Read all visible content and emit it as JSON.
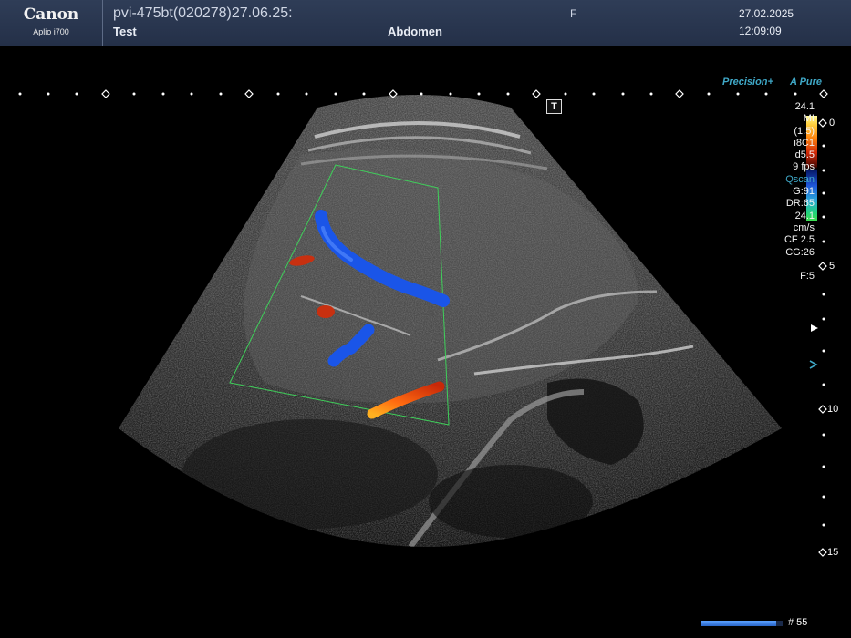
{
  "header": {
    "brand": "Canon",
    "model": "Aplio i700",
    "patient_id": "pvi-475bt(020278)27.06.25:",
    "patient_name": "Test",
    "preset": "Abdomen",
    "sex": "F",
    "date": "27.02.2025",
    "time": "12:09:09"
  },
  "modes": {
    "precision": "Precision+",
    "apure": "A Pure"
  },
  "t_marker": "T",
  "parameters": {
    "scale_top": "24.1",
    "mi": "MI",
    "mi_value": "(1.5)",
    "probe": "i8C1",
    "depth": "d5.5",
    "frame_rate": "9 fps",
    "qscan": "Qscan",
    "gain": "G:91",
    "dynamic_range": "DR:65",
    "scale_bottom": "24.1",
    "velocity_unit": "cm/s",
    "color_freq": "CF 2.5",
    "color_gain": "CG:26",
    "focus_count": "F:5"
  },
  "depth_scale": {
    "labels": [
      "0",
      "5",
      "10",
      "15"
    ]
  },
  "cine": {
    "progress": 0.92,
    "frame_label": "# 55"
  },
  "colors": {
    "header_bg": "#2b3853",
    "doppler_red": "#d43a10",
    "doppler_blue": "#1a55e8",
    "roi_box": "#3fcf5a",
    "mode_text": "#3fa8c7"
  }
}
